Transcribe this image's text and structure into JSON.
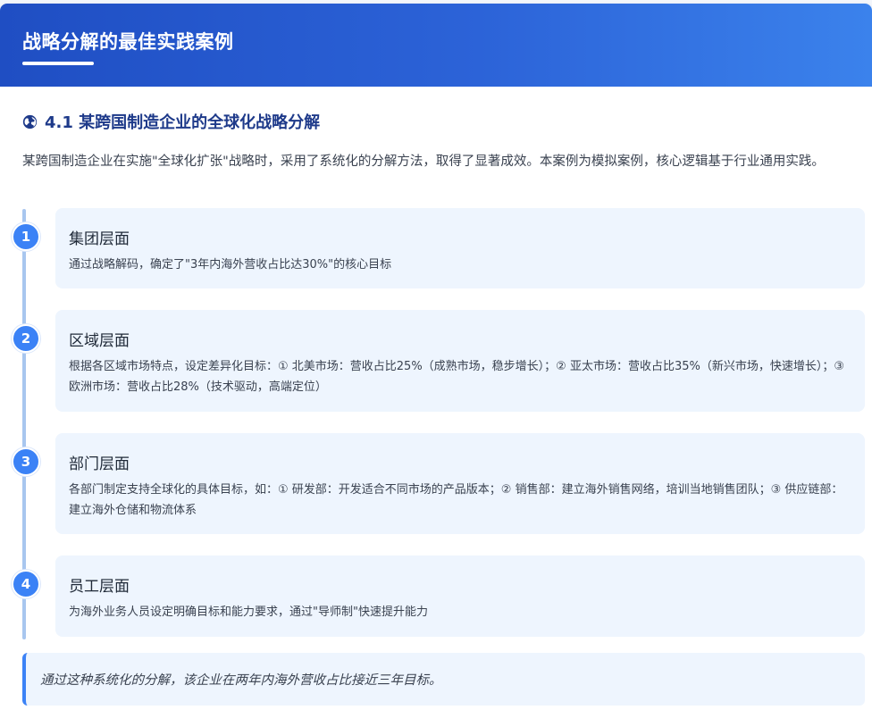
{
  "header": {
    "title": "战略分解的最佳实践案例"
  },
  "section": {
    "icon": "globe-icon",
    "title": "4.1 某跨国制造企业的全球化战略分解",
    "intro": "某跨国制造企业在实施\"全球化扩张\"战略时，采用了系统化的分解方法，取得了显著成效。本案例为模拟案例，核心逻辑基于行业通用实践。"
  },
  "steps": [
    {
      "number": "1",
      "title": "集团层面",
      "description": "通过战略解码，确定了\"3年内海外营收占比达30%\"的核心目标"
    },
    {
      "number": "2",
      "title": "区域层面",
      "description": "根据各区域市场特点，设定差异化目标：① 北美市场：营收占比25%（成熟市场，稳步增长）；② 亚太市场：营收占比35%（新兴市场，快速增长）；③ 欧洲市场：营收占比28%（技术驱动，高端定位）"
    },
    {
      "number": "3",
      "title": "部门层面",
      "description": "各部门制定支持全球化的具体目标，如：① 研发部：开发适合不同市场的产品版本；② 销售部：建立海外销售网络，培训当地销售团队；③ 供应链部：建立海外仓储和物流体系"
    },
    {
      "number": "4",
      "title": "员工层面",
      "description": "为海外业务人员设定明确目标和能力要求，通过\"导师制\"快速提升能力"
    }
  ],
  "conclusion": {
    "text": "通过这种系统化的分解，该企业在两年内海外营收占比接近三年目标。"
  },
  "colors": {
    "header_gradient_start": "#1f4ec3",
    "header_gradient_end": "#3b82ec",
    "section_title": "#1e3a8a",
    "step_circle": "#3b82f6",
    "step_box": "#eef5fe",
    "timeline": "#a8c6ef"
  }
}
